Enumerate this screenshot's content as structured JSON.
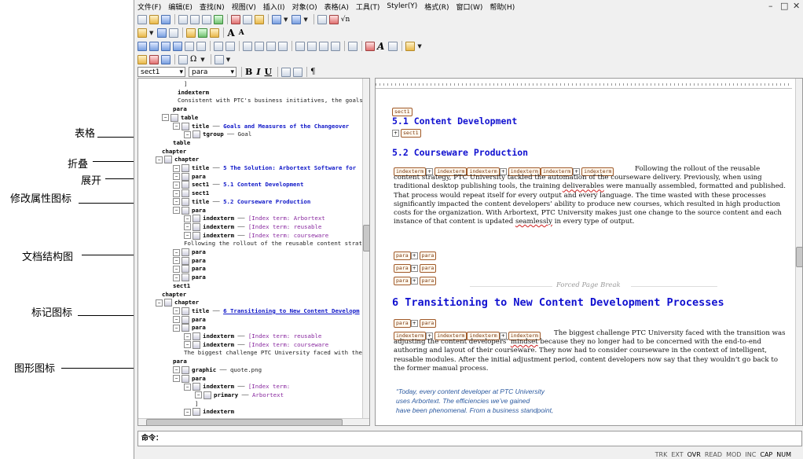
{
  "annotations": [
    {
      "label": "表格"
    },
    {
      "label": "折叠"
    },
    {
      "label": "展开"
    },
    {
      "label": "修改属性图标"
    },
    {
      "label": "文档结构图"
    },
    {
      "label": "标记图标"
    },
    {
      "label": "图形图标"
    }
  ],
  "menu": [
    "文件(F)",
    "编辑(E)",
    "查找(N)",
    "视图(V)",
    "插入(I)",
    "对象(O)",
    "表格(A)",
    "工具(T)",
    "Styler(Y)",
    "格式(R)",
    "窗口(W)",
    "帮助(H)"
  ],
  "window_buttons": {
    "minimize": "–",
    "restore": "□",
    "close": "✕"
  },
  "format_bar": {
    "element_combo": "sect1",
    "style_combo": "para",
    "bold": "B",
    "italic": "I",
    "underline": "U",
    "pilcrow": "¶"
  },
  "toolbar": {
    "font_size_up": "A",
    "font_size_down": "A",
    "sqrt": "√n",
    "omega": "Ω"
  },
  "tree": {
    "lines": [
      {
        "text": "]",
        "bold": false
      },
      {
        "label": "indexterm",
        "text": ""
      },
      {
        "text": "Consistent with PTC's business initiatives, the goals of"
      },
      {
        "label": "para",
        "text": ""
      },
      {
        "label": "table",
        "text": ""
      },
      {
        "label": "title",
        "text": "Goals and Measures of the Changeover"
      },
      {
        "label": "tgroup",
        "text": "Goal"
      },
      {
        "label": "table",
        "text": ""
      },
      {
        "label": "chapter",
        "text": ""
      },
      {
        "label": "chapter",
        "text": ""
      },
      {
        "label": "title",
        "text": "5 The Solution: Arbortext Software for"
      },
      {
        "label": "para",
        "text": ""
      },
      {
        "label": "sect1",
        "text": "5.1 Content Development"
      },
      {
        "label": "sect1",
        "text": ""
      },
      {
        "label": "title",
        "text": "5.2 Courseware Production"
      },
      {
        "label": "para",
        "text": ""
      },
      {
        "label": "indexterm",
        "text": "[Index term: Arbortext"
      },
      {
        "label": "indexterm",
        "text": "[Index term: reusable"
      },
      {
        "label": "indexterm",
        "text": "[Index term: courseware"
      },
      {
        "text": "Following the rollout of the reusable content strategy"
      },
      {
        "label": "para",
        "text": ""
      },
      {
        "label": "para",
        "text": ""
      },
      {
        "label": "para",
        "text": ""
      },
      {
        "label": "para",
        "text": ""
      },
      {
        "label": "sect1",
        "text": ""
      },
      {
        "label": "chapter",
        "text": ""
      },
      {
        "label": "chapter",
        "text": ""
      },
      {
        "label": "title",
        "text": "6 Transitioning to New Content Developm"
      },
      {
        "label": "para",
        "text": ""
      },
      {
        "label": "para",
        "text": ""
      },
      {
        "label": "indexterm",
        "text": "[Index term: reusable"
      },
      {
        "label": "indexterm",
        "text": "[Index term: courseware"
      },
      {
        "text": "The biggest challenge PTC University faced with the trans"
      },
      {
        "label": "para",
        "text": ""
      },
      {
        "label": "graphic",
        "text": "quote.png"
      },
      {
        "label": "para",
        "text": ""
      },
      {
        "label": "indexterm",
        "text": "[Index term:"
      },
      {
        "label": "primary",
        "text": "Arbortext"
      },
      {
        "text": "]"
      },
      {
        "label": "indexterm",
        "text": ""
      }
    ]
  },
  "editor": {
    "tag_sect1": "sect1",
    "tag_para": "para",
    "tag_indexterm": "indexterm",
    "h_51": "5.1 Content Development",
    "h_52": "5.2 Courseware Production",
    "p1_a": "Following the rollout of the reusable content strategy, PTC University tackled the automation of the courseware delivery. Previously, when using traditional desktop publishing tools, the training ",
    "p1_err1": "deliverables",
    "p1_b": " were manually assembled, formatted and published. That process would repeat itself for every output and every language. The time wasted with these processes significantly impacted the content developers’ ability to produce new courses, which resulted in high production costs for the organization. With Arbortext, PTC University makes just one change to the source content and each instance of that content is updated ",
    "p1_err2": "seamlessly",
    "p1_c": " in every type of output.",
    "forced_break": "Forced Page Break",
    "h_6": "6 Transitioning to New Content Development Processes",
    "p2_a": "The biggest challenge PTC University faced with the transition was adjusting the content developers’ ",
    "p2_err": "mindset",
    "p2_b": " because they no longer had to be concerned with the end-to-end authoring and layout of their courseware. They now had to consider courseware in the context of intelligent, reusable modules. After the initial adjustment period, content developers now say that they wouldn’t go back to the former manual process.",
    "quote_1": "“Today, every content developer at PTC University",
    "quote_2": "uses Arbortext.  The efficiencies we’ve gained",
    "quote_3": "have been phenomenal.  From a business standpoint,"
  },
  "command": {
    "label": "命令："
  },
  "status": [
    {
      "text": "TRK",
      "on": false
    },
    {
      "text": "EXT",
      "on": false
    },
    {
      "text": "OVR",
      "on": true
    },
    {
      "text": "READ",
      "on": false
    },
    {
      "text": "MOD",
      "on": false
    },
    {
      "text": "INC",
      "on": false
    },
    {
      "text": "CAP",
      "on": true
    },
    {
      "text": "NUM",
      "on": true
    }
  ]
}
